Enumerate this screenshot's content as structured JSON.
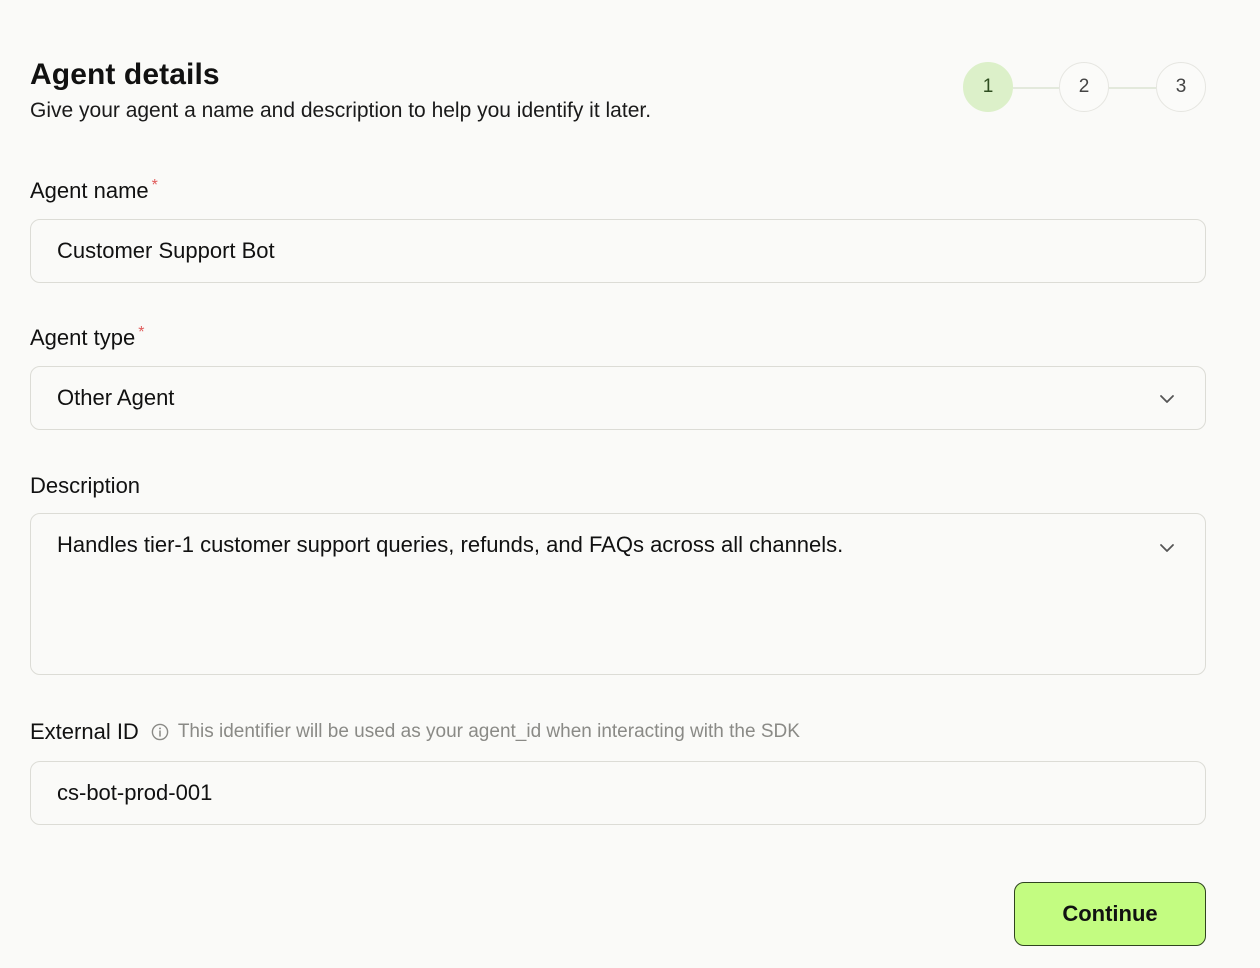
{
  "header": {
    "title": "Agent details",
    "subtitle": "Give your agent a name and description to help you identify it later."
  },
  "stepper": {
    "steps": [
      {
        "label": "1",
        "active": true
      },
      {
        "label": "2",
        "active": false
      },
      {
        "label": "3",
        "active": false
      }
    ]
  },
  "form": {
    "agent_name": {
      "label": "Agent name",
      "required_mark": "*",
      "value": "Customer Support Bot"
    },
    "agent_type": {
      "label": "Agent type",
      "required_mark": "*",
      "value": "Other Agent"
    },
    "description": {
      "label": "Description",
      "value": "Handles tier-1 customer support queries, refunds, and FAQs across all channels."
    },
    "external_id": {
      "label": "External ID",
      "hint": "This identifier will be used as your agent_id when interacting with the SDK",
      "value": "cs-bot-prod-001"
    }
  },
  "actions": {
    "continue_label": "Continue"
  },
  "icons": {
    "chevron": "chevron-down-icon",
    "info": "info-icon"
  },
  "colors": {
    "accent": "#c3fc81",
    "active_step": "#dcf0c9",
    "required": "#e05a5a",
    "background": "#fafaf8"
  }
}
